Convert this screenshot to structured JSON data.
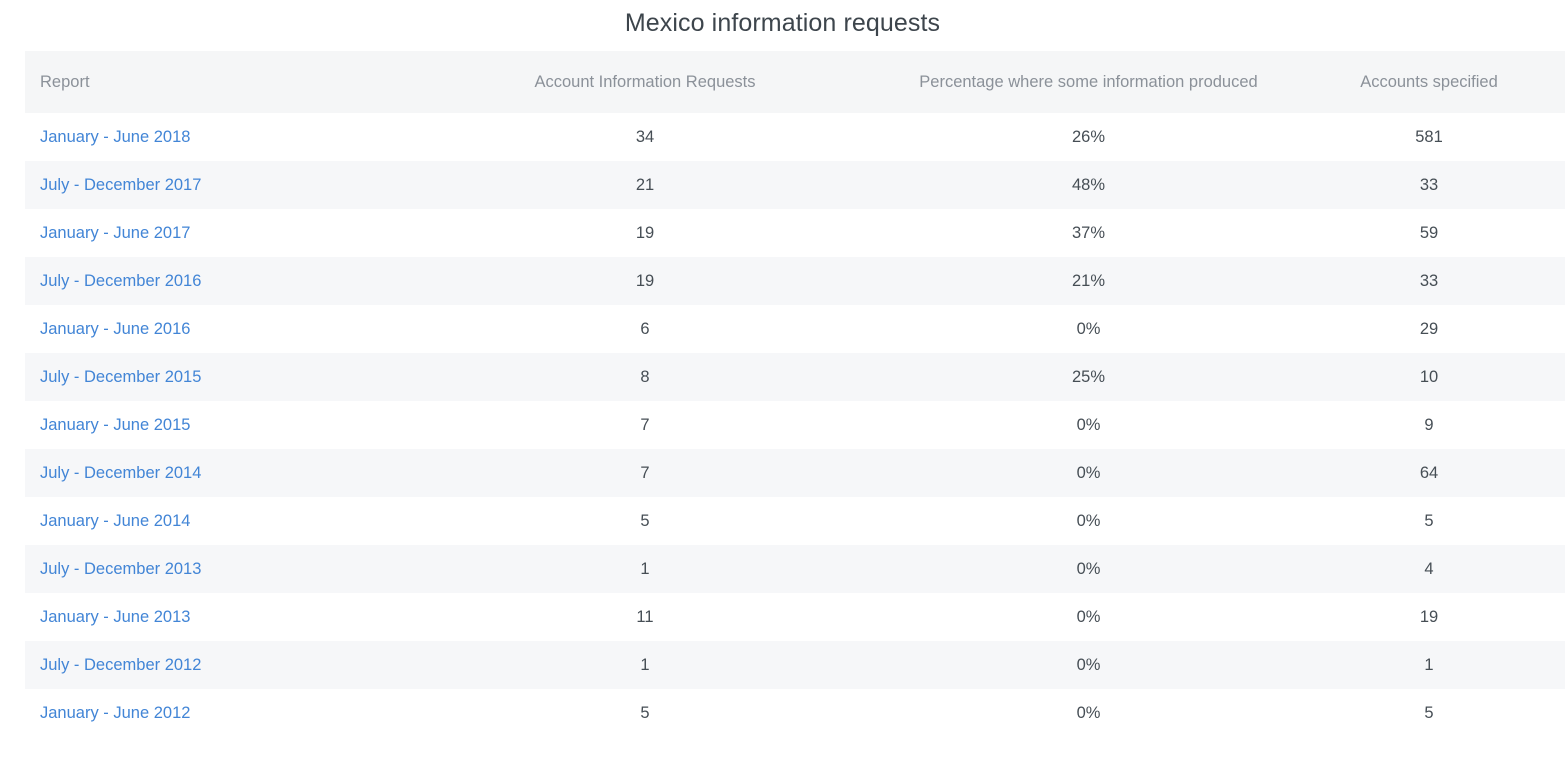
{
  "page": {
    "title": "Mexico information requests",
    "background_color": "#ffffff",
    "title_color": "#3d454c",
    "link_color": "#4285d6",
    "header_background_color": "#f5f6f7",
    "header_text_color": "#8b9199",
    "stripe_color": "#f6f7f9",
    "cell_text_color": "#464e55"
  },
  "table": {
    "columns": [
      {
        "key": "report",
        "label": "Report",
        "align": "left"
      },
      {
        "key": "requests",
        "label": "Account Information Requests",
        "align": "center"
      },
      {
        "key": "percentage",
        "label": "Percentage where some information produced",
        "align": "center"
      },
      {
        "key": "accounts",
        "label": "Accounts specified",
        "align": "center"
      }
    ],
    "rows": [
      {
        "report": "January - June 2018",
        "requests": "34",
        "percentage": "26%",
        "accounts": "581"
      },
      {
        "report": "July - December 2017",
        "requests": "21",
        "percentage": "48%",
        "accounts": "33"
      },
      {
        "report": "January - June 2017",
        "requests": "19",
        "percentage": "37%",
        "accounts": "59"
      },
      {
        "report": "July - December 2016",
        "requests": "19",
        "percentage": "21%",
        "accounts": "33"
      },
      {
        "report": "January - June 2016",
        "requests": "6",
        "percentage": "0%",
        "accounts": "29"
      },
      {
        "report": "July - December 2015",
        "requests": "8",
        "percentage": "25%",
        "accounts": "10"
      },
      {
        "report": "January - June 2015",
        "requests": "7",
        "percentage": "0%",
        "accounts": "9"
      },
      {
        "report": "July - December 2014",
        "requests": "7",
        "percentage": "0%",
        "accounts": "64"
      },
      {
        "report": "January - June 2014",
        "requests": "5",
        "percentage": "0%",
        "accounts": "5"
      },
      {
        "report": "July - December 2013",
        "requests": "1",
        "percentage": "0%",
        "accounts": "4"
      },
      {
        "report": "January - June 2013",
        "requests": "11",
        "percentage": "0%",
        "accounts": "19"
      },
      {
        "report": "July - December 2012",
        "requests": "1",
        "percentage": "0%",
        "accounts": "1"
      },
      {
        "report": "January - June 2012",
        "requests": "5",
        "percentage": "0%",
        "accounts": "5"
      }
    ]
  },
  "chart_data": {
    "type": "table",
    "title": "Mexico information requests",
    "columns": [
      "Report",
      "Account Information Requests",
      "Percentage where some information produced",
      "Accounts specified"
    ],
    "rows": [
      [
        "January - June 2018",
        34,
        "26%",
        581
      ],
      [
        "July - December 2017",
        21,
        "48%",
        33
      ],
      [
        "January - June 2017",
        19,
        "37%",
        59
      ],
      [
        "July - December 2016",
        19,
        "21%",
        33
      ],
      [
        "January - June 2016",
        6,
        "0%",
        29
      ],
      [
        "July - December 2015",
        8,
        "25%",
        10
      ],
      [
        "January - June 2015",
        7,
        "0%",
        9
      ],
      [
        "July - December 2014",
        7,
        "0%",
        64
      ],
      [
        "January - June 2014",
        5,
        "0%",
        5
      ],
      [
        "July - December 2013",
        1,
        "0%",
        4
      ],
      [
        "January - June 2013",
        11,
        "0%",
        19
      ],
      [
        "July - December 2012",
        1,
        "0%",
        1
      ],
      [
        "January - June 2012",
        5,
        "0%",
        5
      ]
    ]
  }
}
